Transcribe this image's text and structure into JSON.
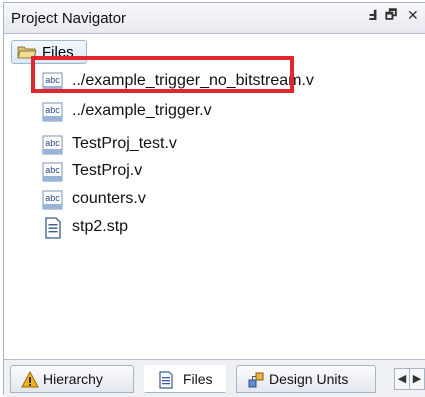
{
  "panel": {
    "title": "Project Navigator",
    "pin_glyph": "Ⅎ",
    "restore_glyph": "🗗",
    "close_glyph": "✕"
  },
  "tree": {
    "root": {
      "label": "Files",
      "icon": "open-folder-icon"
    },
    "items": [
      {
        "label": "../example_trigger_no_bitstream.v",
        "icon": "verilog-file-icon",
        "icon_text": "abc"
      },
      {
        "label": "../example_trigger.v",
        "icon": "verilog-file-icon",
        "icon_text": "abc",
        "highlighted": true
      },
      {
        "label": "TestProj_test.v",
        "icon": "verilog-file-icon",
        "icon_text": "abc"
      },
      {
        "label": "TestProj.v",
        "icon": "verilog-file-icon",
        "icon_text": "abc"
      },
      {
        "label": "counters.v",
        "icon": "verilog-file-icon",
        "icon_text": "abc"
      },
      {
        "label": "stp2.stp",
        "icon": "document-icon"
      }
    ]
  },
  "tabs": [
    {
      "label": "Hierarchy",
      "icon": "warning-triangle-icon",
      "active": false
    },
    {
      "label": "Files",
      "icon": "document-icon",
      "active": true
    },
    {
      "label": "Design Units",
      "icon": "design-units-icon",
      "active": false
    }
  ],
  "colors": {
    "highlight_border": "#e0262f",
    "root_selection": "#dde8f6"
  },
  "scroll": {
    "left_glyph": "◀",
    "right_glyph": "▶"
  }
}
